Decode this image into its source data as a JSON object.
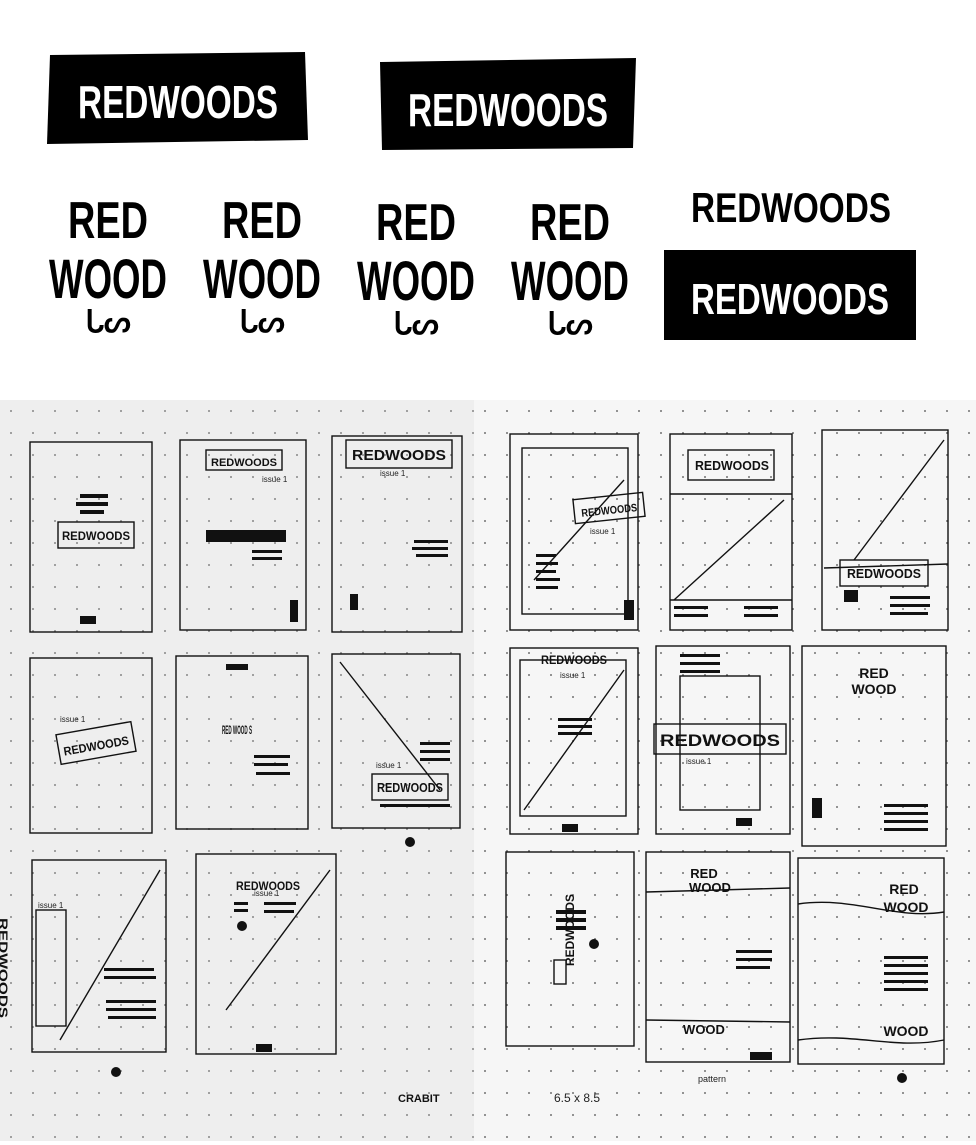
{
  "logos": {
    "wordmark": "REDWOODS",
    "stack_line1": "RED",
    "stack_line2": "WOOD",
    "stack_glyph": "ᒐᔕ"
  },
  "sketches": {
    "issue_label": "issue 1",
    "sketch_wordmark": "REDWOODS",
    "vertical_word": "RED WOOD S",
    "size_note": "6.5 x 8.5",
    "pattern_note": "pattern",
    "brand_mark": "CRABIT"
  }
}
